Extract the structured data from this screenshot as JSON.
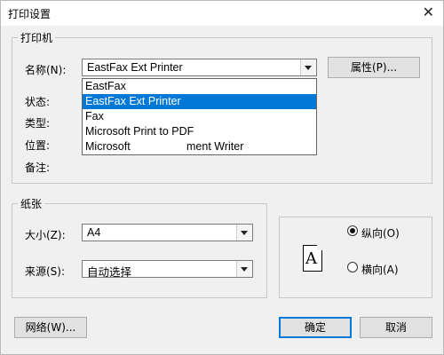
{
  "window": {
    "title": "打印设置",
    "close_glyph": "✕"
  },
  "printer": {
    "group_label": "打印机",
    "name_label": "名称(N):",
    "name_value": "EastFax Ext Printer",
    "properties_button": "属性(P)...",
    "status_label": "状态:",
    "type_label": "类型:",
    "location_label": "位置:",
    "comment_label": "备注:",
    "options": [
      {
        "label": "EastFax",
        "selected": false
      },
      {
        "label": "EastFax Ext Printer",
        "selected": true
      },
      {
        "label": "Fax",
        "selected": false
      },
      {
        "label": "Microsoft Print to PDF",
        "selected": false
      },
      {
        "label": "Microsoft",
        "tail": "ment Writer",
        "selected": false
      }
    ]
  },
  "paper": {
    "group_label": "纸张",
    "size_label": "大小(Z):",
    "size_value": "A4",
    "source_label": "来源(S):",
    "source_value": "自动选择"
  },
  "orientation": {
    "icon_letter": "A",
    "portrait_label": "纵向(O)",
    "landscape_label": "横向(A)",
    "selected": "portrait"
  },
  "buttons": {
    "network": "网络(W)...",
    "ok": "确定",
    "cancel": "取消"
  },
  "colors": {
    "selection": "#0078d7",
    "default_button_border": "#0078d7"
  }
}
